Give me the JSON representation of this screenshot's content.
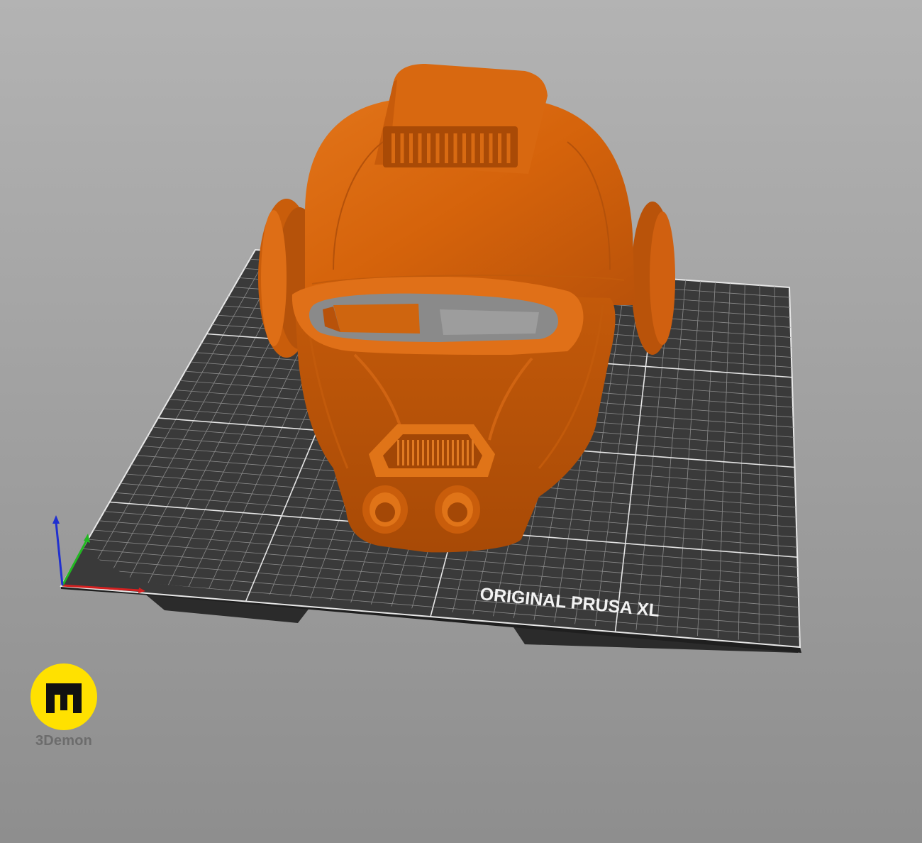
{
  "viewport": {
    "background_top": "#b3b3b3",
    "background_bottom": "#8e8e8e"
  },
  "bed": {
    "label": "ORIGINAL PRUSA XL",
    "surface_color": "#3a3a3a",
    "grid_color": "#8a8a8a",
    "major_grid_color": "#e6e6e6"
  },
  "model": {
    "description_icon": "helmet-model",
    "color": "#d5630b"
  },
  "axes": {
    "x_color": "#d42020",
    "y_color": "#22b822",
    "z_color": "#2030d0"
  },
  "watermark": {
    "name": "3Demon",
    "logo_color": "#ffe100",
    "icon": "3demon-logo-icon"
  }
}
